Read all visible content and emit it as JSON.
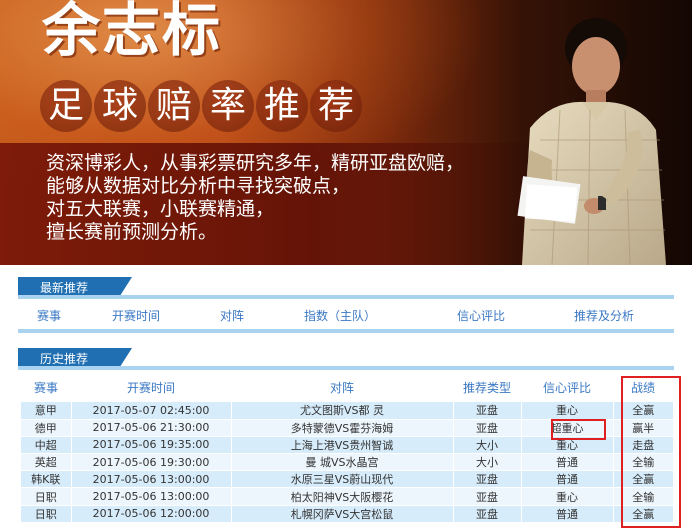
{
  "banner": {
    "name": "余志标",
    "subtitle_chars": [
      "足",
      "球",
      "赔",
      "率",
      "推",
      "荐"
    ],
    "intro_lines": [
      "资深博彩人，从事彩票研究多年，精研亚盘欧赔，",
      "能够从数据对比分析中寻找突破点，",
      "对五大联赛，小联赛精通，",
      "擅长赛前预测分析。"
    ]
  },
  "latest": {
    "tab_label": "最新推荐",
    "headers": [
      "赛事",
      "开赛时间",
      "对阵",
      "指数（主队）",
      "信心评比",
      "推荐及分析"
    ]
  },
  "history": {
    "tab_label": "历史推荐",
    "headers": [
      "赛事",
      "开赛时间",
      "对阵",
      "推荐类型",
      "信心评比",
      "战绩"
    ],
    "rows": [
      {
        "league": "意甲",
        "time": "2017-05-07 02:45:00",
        "match": "尤文图斯VS都 灵",
        "type": "亚盘",
        "confidence": "重心",
        "result": "全赢"
      },
      {
        "league": "德甲",
        "time": "2017-05-06 21:30:00",
        "match": "多特蒙德VS霍芬海姆",
        "type": "亚盘",
        "confidence": "超重心",
        "result": "赢半"
      },
      {
        "league": "中超",
        "time": "2017-05-06 19:35:00",
        "match": "上海上港VS贵州智诚",
        "type": "大小",
        "confidence": "重心",
        "result": "走盘"
      },
      {
        "league": "英超",
        "time": "2017-05-06 19:30:00",
        "match": "曼 城VS水晶宫",
        "type": "大小",
        "confidence": "普通",
        "result": "全输"
      },
      {
        "league": "韩K联",
        "time": "2017-05-06 13:00:00",
        "match": "水原三星VS蔚山现代",
        "type": "亚盘",
        "confidence": "普通",
        "result": "全赢"
      },
      {
        "league": "日职",
        "time": "2017-05-06 13:00:00",
        "match": "柏太阳神VS大阪樱花",
        "type": "亚盘",
        "confidence": "重心",
        "result": "全输"
      },
      {
        "league": "日职",
        "time": "2017-05-06 12:00:00",
        "match": "札幌冈萨VS大宫松鼠",
        "type": "亚盘",
        "confidence": "普通",
        "result": "全赢"
      }
    ]
  },
  "colors": {
    "tab_blue": "#1f6fb2",
    "header_text": "#3a78c3",
    "highlight_red": "#e02020"
  }
}
